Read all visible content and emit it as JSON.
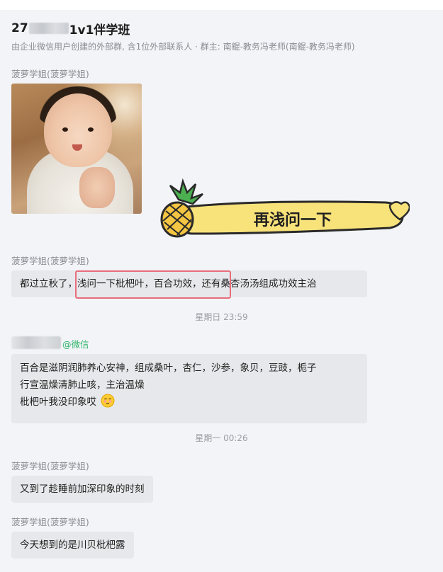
{
  "header": {
    "title_prefix": "27",
    "title_suffix": "1v1伴学班",
    "subtitle": "由企业微信用户创建的外部群, 含1位外部联系人 · 群主: 南鲲-教务冯老师(南鲲-教务冯老师)"
  },
  "messages": [
    {
      "sender": "菠萝学姐(菠萝学姐)"
    },
    {
      "sender": "菠萝学姐(菠萝学姐)",
      "text": "都过立秋了，浅问一下枇杷叶，百合功效，还有桑杏汤汤组成功效主治"
    },
    {
      "time": "星期日 23:59"
    },
    {
      "sender_tag": "@微信",
      "lines": [
        "百合是滋阴润肺养心安神，组成桑叶，杏仁，沙参，象贝，豆豉，栀子",
        "行宣温燥清肺止咳，主治温燥",
        "枇杷叶我没印象哎"
      ]
    },
    {
      "time": "星期一 00:26"
    },
    {
      "sender": "菠萝学姐(菠萝学姐)",
      "text": "又到了趁睡前加深印象的时刻"
    },
    {
      "sender": "菠萝学姐(菠萝学姐)",
      "text": "今天想到的是川贝枇杷露"
    }
  ],
  "sticker": {
    "text": "再浅问一下"
  },
  "colors": {
    "bubble": "#e7e8eb",
    "background": "#f3f4f7",
    "highlight": "#e86d7c",
    "wechat_green": "#30b46a",
    "sticker_yellow": "#f8e27a"
  }
}
